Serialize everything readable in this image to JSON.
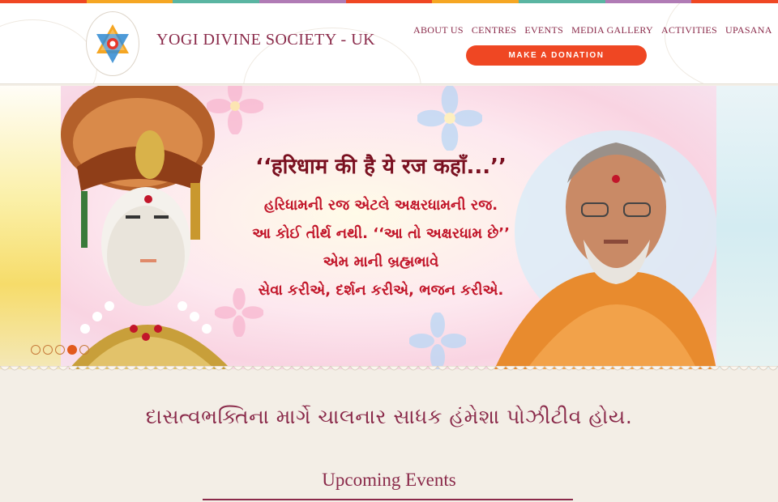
{
  "colors": {
    "stripe": [
      "#ef4723",
      "#f5a623",
      "#5ab5a2",
      "#b07bb5",
      "#ef4723",
      "#f5a623",
      "#5ab5a2",
      "#b07bb5",
      "#ef4723"
    ],
    "brand": "#8a2a4a",
    "donate": "#ef4723"
  },
  "header": {
    "logo_icon": "star-of-david-logo-icon",
    "brand_name": "YOGI DIVINE SOCIETY - UK",
    "nav": [
      "ABOUT US",
      "CENTRES",
      "EVENTS",
      "MEDIA GALLERY",
      "ACTIVITIES",
      "UPASANA"
    ],
    "donate_label": "MAKE A DONATION"
  },
  "slider": {
    "headline": "‘‘हरिधाम की है ये रज कहाँ...’’",
    "lines": [
      "હરિધામની રજ એટલે અક્ષરધામની રજ.",
      "આ કોઈ તીર્થ નથી. ‘‘આ તો અક્ષરધામ છે’’",
      "એમ માની બ્રહ્મભાવે",
      "સેવા કરીએ, દર્શન કરીએ, ભજન કરીએ."
    ],
    "slide_count": 5,
    "active_slide": 4
  },
  "quote": "દાસત્વભક્તિના માર્ગે ચાલનાર સાધક હંમેશા પોઝીટીવ હોય.",
  "upcoming_title": "Upcoming Events"
}
